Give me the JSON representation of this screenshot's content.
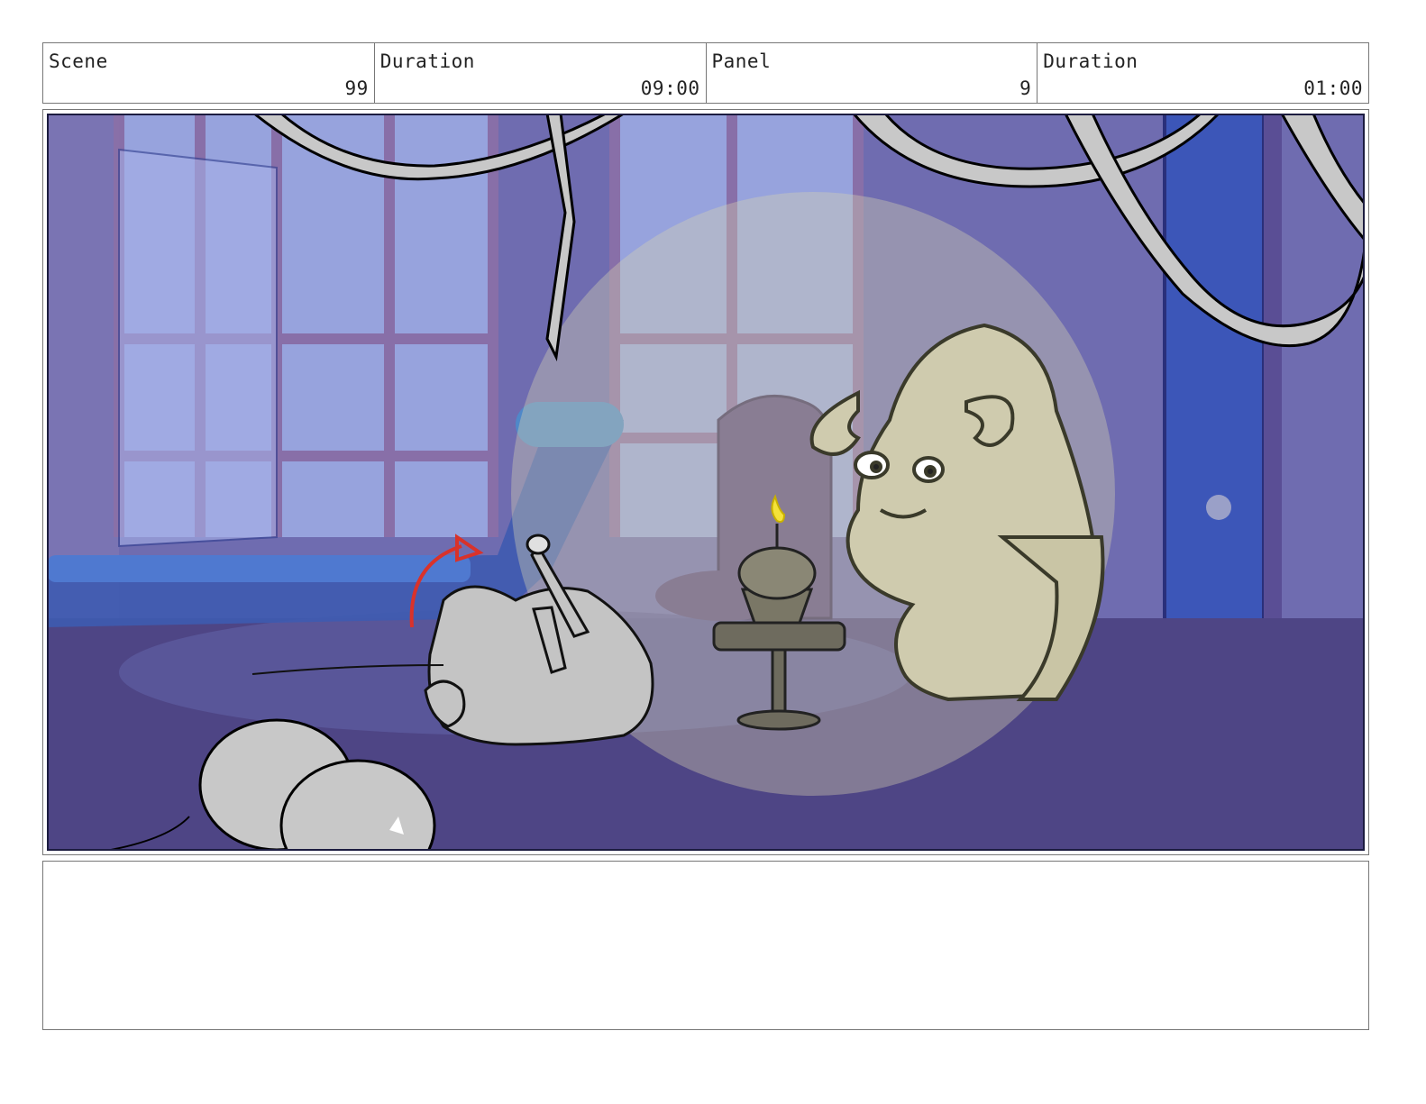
{
  "header": {
    "scene_label": "Scene",
    "scene_value": "99",
    "scene_duration_label": "Duration",
    "scene_duration_value": "09:00",
    "panel_label": "Panel",
    "panel_value": "9",
    "panel_duration_label": "Duration",
    "panel_duration_value": "01:00"
  },
  "panel": {
    "colors": {
      "room": "#6f6cb0",
      "floor": "#4e4585",
      "window_glow": "#9aa6e0",
      "spotlight": "#d8d3b0",
      "ram_fill": "#cfcbae",
      "cat_fill": "#c4c4c4",
      "candle_flame": "#f4e23a",
      "motion_arrow": "#d9322a"
    }
  },
  "notes": ""
}
